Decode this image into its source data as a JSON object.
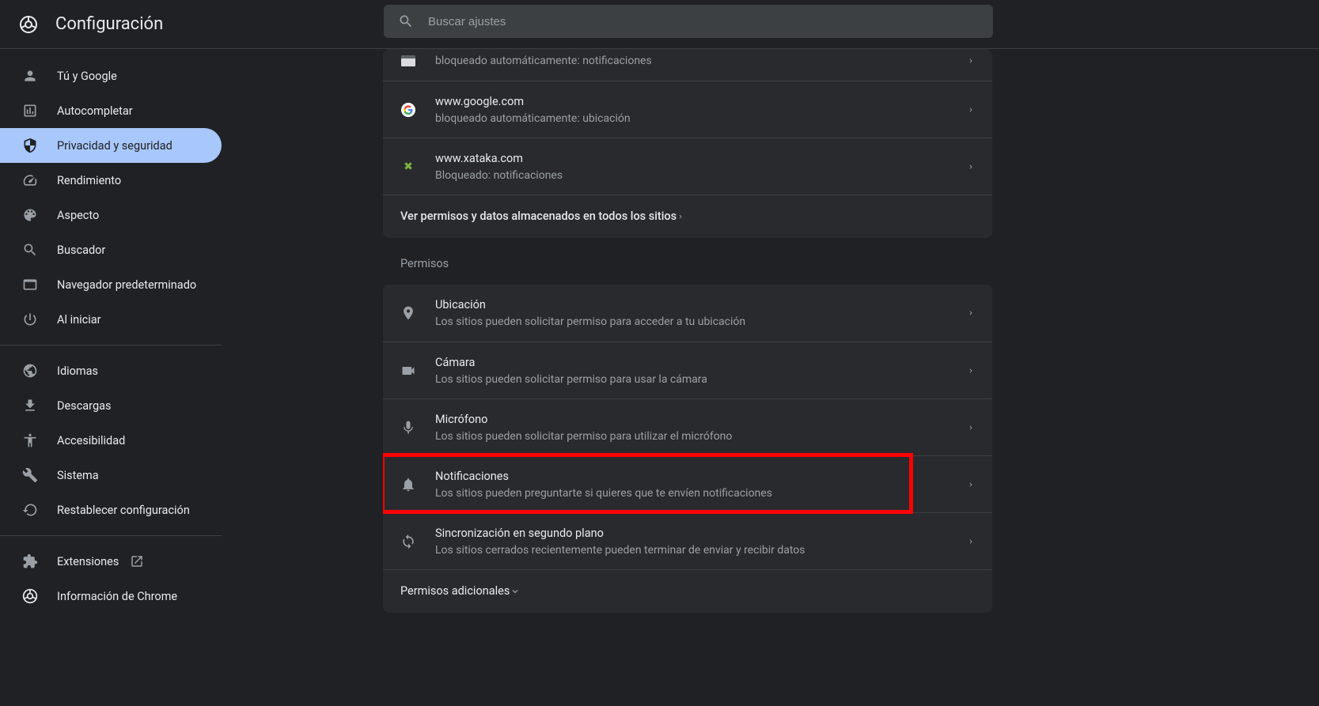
{
  "header": {
    "title": "Configuración",
    "search_placeholder": "Buscar ajustes"
  },
  "sidebar": {
    "items": [
      {
        "icon": "person",
        "label": "Tú y Google"
      },
      {
        "icon": "autofill",
        "label": "Autocompletar"
      },
      {
        "icon": "shield",
        "label": "Privacidad y seguridad",
        "active": true
      },
      {
        "icon": "performance",
        "label": "Rendimiento"
      },
      {
        "icon": "palette",
        "label": "Aspecto"
      },
      {
        "icon": "search",
        "label": "Buscador"
      },
      {
        "icon": "browser",
        "label": "Navegador predeterminado"
      },
      {
        "icon": "power",
        "label": "Al iniciar"
      }
    ],
    "items2": [
      {
        "icon": "globe",
        "label": "Idiomas"
      },
      {
        "icon": "download",
        "label": "Descargas"
      },
      {
        "icon": "accessibility",
        "label": "Accesibilidad"
      },
      {
        "icon": "wrench",
        "label": "Sistema"
      },
      {
        "icon": "reset",
        "label": "Restablecer configuración"
      }
    ],
    "items3": [
      {
        "icon": "extension",
        "label": "Extensiones",
        "external": true
      },
      {
        "icon": "chrome",
        "label": "Información de Chrome"
      }
    ]
  },
  "sites": [
    {
      "icon": "url",
      "title": "",
      "desc": "bloqueado automáticamente: notificaciones"
    },
    {
      "icon": "google",
      "title": "www.google.com",
      "desc": "bloqueado automáticamente: ubicación"
    },
    {
      "icon": "xataka",
      "title": "www.xataka.com",
      "desc": "Bloqueado: notificaciones"
    }
  ],
  "view_all_link": "Ver permisos y datos almacenados en todos los sitios",
  "permissions_label": "Permisos",
  "permissions": [
    {
      "icon": "location",
      "title": "Ubicación",
      "desc": "Los sitios pueden solicitar permiso para acceder a tu ubicación"
    },
    {
      "icon": "camera",
      "title": "Cámara",
      "desc": "Los sitios pueden solicitar permiso para usar la cámara"
    },
    {
      "icon": "mic",
      "title": "Micrófono",
      "desc": "Los sitios pueden solicitar permiso para utilizar el micrófono"
    },
    {
      "icon": "bell",
      "title": "Notificaciones",
      "desc": "Los sitios pueden preguntarte si quieres que te envíen notificaciones",
      "highlighted": true
    },
    {
      "icon": "sync",
      "title": "Sincronización en segundo plano",
      "desc": "Los sitios cerrados recientemente pueden terminar de enviar y recibir datos"
    }
  ],
  "additional_permissions": "Permisos adicionales"
}
